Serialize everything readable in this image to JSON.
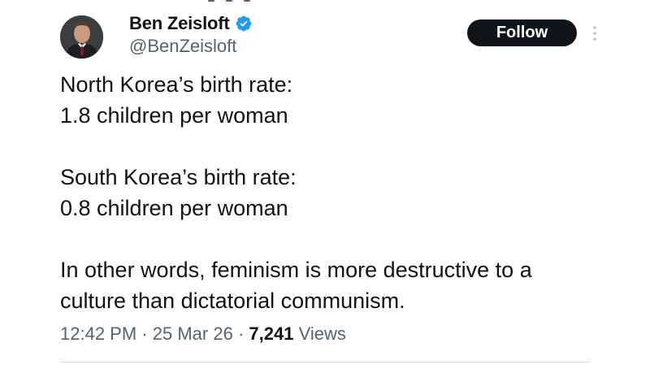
{
  "author": {
    "name": "Ben Zeisloft",
    "handle": "@BenZeisloft",
    "verified_color": "#1d9bf0",
    "avatar_icon": "profile-photo"
  },
  "follow_button": {
    "label": "Follow"
  },
  "more_icon": "more-vertical-icon",
  "tweet": {
    "paragraphs": [
      [
        "North Korea’s birth rate:",
        "1.8 children per woman"
      ],
      [
        "South Korea’s birth rate:",
        "0.8 children per woman"
      ],
      [
        "In other words, feminism is more destructive to a",
        "culture than dictatorial communism."
      ]
    ]
  },
  "meta": {
    "time": "12:42 PM",
    "separator": "·",
    "date": "25 Mar 26",
    "views_count": "7,241",
    "views_label": "Views"
  },
  "colors": {
    "text_primary": "#0f1419",
    "text_secondary": "#536471",
    "divider": "#cfd9de",
    "follow_bg": "#0f1419"
  }
}
